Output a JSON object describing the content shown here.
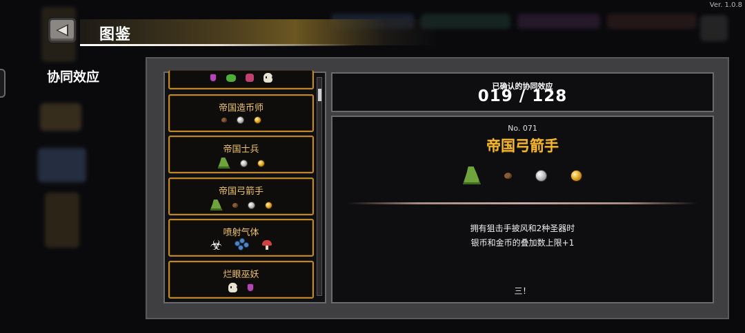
{
  "version": "Ver. 1.0.8",
  "header": {
    "title": "图鉴"
  },
  "side": {
    "heading": "协同效应"
  },
  "list": {
    "items": [
      {
        "label": "",
        "icons": [
          "potion",
          "bug-green",
          "jar-pink",
          "skull"
        ]
      },
      {
        "label": "帝国造币师",
        "icons": [
          "seed",
          "silver",
          "gold"
        ]
      },
      {
        "label": "帝国士兵",
        "icons": [
          "cloak",
          "silver",
          "gold"
        ]
      },
      {
        "label": "帝国弓箭手",
        "icons": [
          "cloak",
          "seed",
          "silver",
          "gold"
        ]
      },
      {
        "label": "喷射气体",
        "icons": [
          "biohazard",
          "mushroom-blue",
          "mushroom-red"
        ]
      },
      {
        "label": "烂眼巫妖",
        "icons": [
          "skull",
          "potion"
        ]
      }
    ]
  },
  "summary": {
    "label": "已确认的协同效应",
    "value": "019 / 128"
  },
  "detail": {
    "number": "No. 071",
    "name": "帝国弓箭手",
    "icons": [
      "cloak",
      "seed",
      "silver",
      "gold"
    ],
    "description_line1": "拥有狙击手披风和2种圣器时",
    "description_line2": "银币和金币的叠加数上限+1",
    "quote": "三！"
  },
  "colors": {
    "accent": "#f3b733",
    "card_border": "#c0872a",
    "card_text": "#f1c56c"
  }
}
